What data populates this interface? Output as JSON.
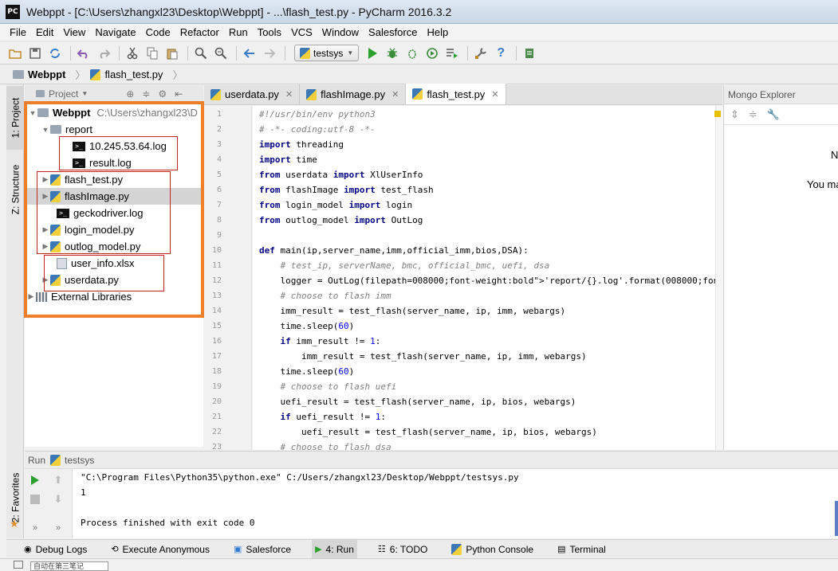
{
  "window": {
    "app_icon": "PC",
    "title": "Webppt - [C:\\Users\\zhangxl23\\Desktop\\Webppt] - ...\\flash_test.py - PyCharm 2016.3.2"
  },
  "menu": [
    "File",
    "Edit",
    "View",
    "Navigate",
    "Code",
    "Refactor",
    "Run",
    "Tools",
    "VCS",
    "Window",
    "Salesforce",
    "Help"
  ],
  "toolbar": {
    "run_config": "testsys",
    "help_glyph": "?"
  },
  "breadcrumb": {
    "project": "Webppt",
    "file": "flash_test.py"
  },
  "side_tabs": {
    "project": "1: Project",
    "structure": "Z: Structure",
    "favorites": "2: Favorites"
  },
  "project_panel": {
    "header": "Project",
    "root_name": "Webppt",
    "root_path": "C:\\Users\\zhangxl23\\D",
    "report_folder": "report",
    "log1": "10.245.53.64.log",
    "log2": "result.log",
    "file_flash_test": "flash_test.py",
    "file_flashimage": "flashImage.py",
    "file_gecko": "geckodriver.log",
    "file_login": "login_model.py",
    "file_outlog": "outlog_model.py",
    "file_userinfo": "user_info.xlsx",
    "file_userdata": "userdata.py",
    "external": "External Libraries",
    "log_icon_text": ">_"
  },
  "editor": {
    "tabs": [
      "userdata.py",
      "flashImage.py",
      "flash_test.py"
    ],
    "active_tab": 2,
    "lines": [
      {
        "n": "1",
        "t": "#!/usr/bin/env python3"
      },
      {
        "n": "2",
        "t": "# -*- coding:utf-8 -*-"
      },
      {
        "n": "3",
        "t": "import threading"
      },
      {
        "n": "4",
        "t": "import time"
      },
      {
        "n": "5",
        "t": "from userdata import XlUserInfo"
      },
      {
        "n": "6",
        "t": "from flashImage import test_flash"
      },
      {
        "n": "7",
        "t": "from login_model import login"
      },
      {
        "n": "8",
        "t": "from outlog_model import OutLog"
      },
      {
        "n": "9",
        "t": ""
      },
      {
        "n": "10",
        "t": "def main(ip,server_name,imm,official_imm,bios,DSA):"
      },
      {
        "n": "11",
        "t": "    # test_ip, serverName, bmc, official_bmc, uefi, dsa"
      },
      {
        "n": "12",
        "t": "    logger = OutLog(filepath='report/{}.log'.format('result'))"
      },
      {
        "n": "13",
        "t": "    # choose to flash imm"
      },
      {
        "n": "14",
        "t": "    imm_result = test_flash(server_name, ip, imm, webargs)"
      },
      {
        "n": "15",
        "t": "    time.sleep(60)"
      },
      {
        "n": "16",
        "t": "    if imm_result != 1:"
      },
      {
        "n": "17",
        "t": "        imm_result = test_flash(server_name, ip, imm, webargs)"
      },
      {
        "n": "18",
        "t": "    time.sleep(60)"
      },
      {
        "n": "19",
        "t": "    # choose to flash uefi"
      },
      {
        "n": "20",
        "t": "    uefi_result = test_flash(server_name, ip, bios, webargs)"
      },
      {
        "n": "21",
        "t": "    if uefi_result != 1:"
      },
      {
        "n": "22",
        "t": "        uefi_result = test_flash(server_name, ip, bios, webargs)"
      },
      {
        "n": "23",
        "t": "    # choose to flash dsa"
      }
    ]
  },
  "mongo": {
    "title": "Mongo Explorer",
    "line1": "N",
    "line2": "You ma"
  },
  "run": {
    "label": "Run",
    "config": "testsys",
    "output": [
      "\"C:\\Program Files\\Python35\\python.exe\" C:/Users/zhangxl23/Desktop/Webppt/testsys.py",
      "1",
      "",
      "Process finished with exit code 0"
    ]
  },
  "bottom_tools": [
    {
      "label": "Debug Logs",
      "icon": "debug-logs-icon"
    },
    {
      "label": "Execute Anonymous",
      "icon": "execute-anonymous-icon"
    },
    {
      "label": "Salesforce",
      "icon": "salesforce-icon"
    },
    {
      "label": "4: Run",
      "icon": "run-icon"
    },
    {
      "label": "6: TODO",
      "icon": "todo-icon"
    },
    {
      "label": "Python Console",
      "icon": "python-console-icon"
    },
    {
      "label": "Terminal",
      "icon": "terminal-icon"
    }
  ],
  "status": {
    "box_text": "自动在第三笔记"
  },
  "colors": {
    "highlight": "#f07f2c",
    "annotation": "#c42424",
    "keyword": "#000080",
    "string": "#008000",
    "comment": "#808080",
    "number": "#0000ff",
    "run_green": "#2ca02c"
  }
}
